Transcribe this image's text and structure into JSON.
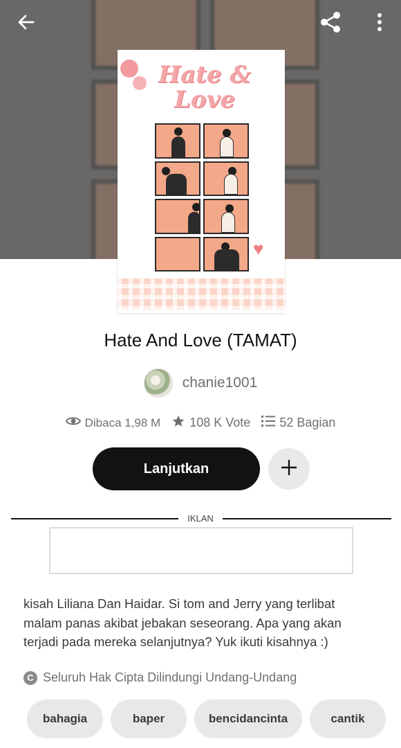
{
  "header": {
    "back_icon": "arrow-left-icon",
    "share_icon": "share-icon",
    "more_icon": "more-vertical-icon"
  },
  "cover": {
    "title_art": "Hate & Love"
  },
  "story": {
    "title": "Hate And Love (TAMAT)",
    "author": "chanie1001",
    "stats": {
      "reads_label": "Dibaca 1,98 M",
      "votes_label": "108 K Vote",
      "parts_label": "52 Bagian"
    }
  },
  "actions": {
    "continue_label": "Lanjutkan",
    "add_icon": "plus-icon"
  },
  "ad": {
    "label": "IKLAN"
  },
  "description": "kisah Liliana Dan Haidar. Si tom and Jerry yang terlibat malam panas akibat jebakan seseorang. Apa yang akan terjadi pada mereka selanjutnya? Yuk ikuti kisahnya :)",
  "copyright": {
    "icon_text": "C",
    "text": "Seluruh Hak Cipta Dilindungi Undang-Undang"
  },
  "tags": [
    "bahagia",
    "baper",
    "bencidancinta",
    "cantik"
  ],
  "colors": {
    "primary_button": "#121212",
    "muted_text": "#6f6f6f",
    "chip_bg": "#e8e8e8",
    "cover_peach": "#f3a889"
  }
}
